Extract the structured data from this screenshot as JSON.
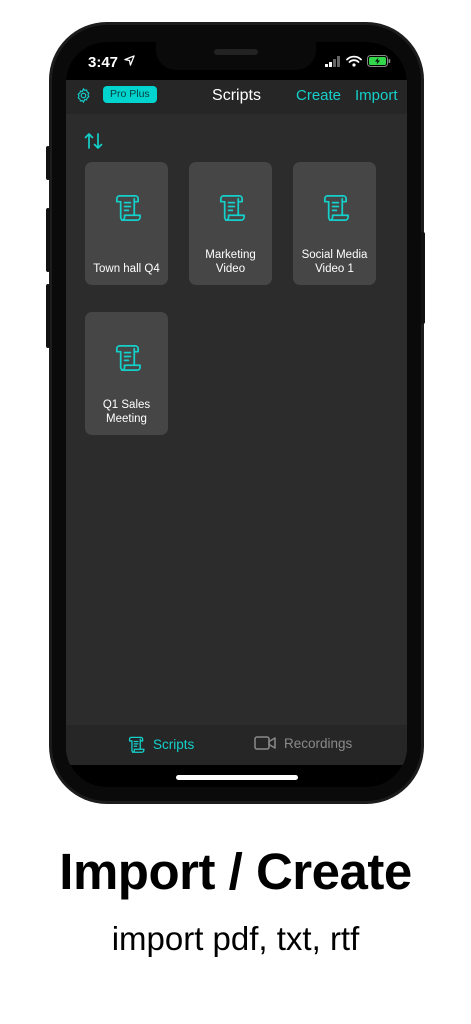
{
  "status_bar": {
    "time": "3:47"
  },
  "nav": {
    "badge": "Pro Plus",
    "title": "Scripts",
    "create": "Create",
    "import": "Import"
  },
  "scripts": [
    {
      "title": "Town hall Q4"
    },
    {
      "title": "Marketing\nVideo"
    },
    {
      "title": "Social Media\nVideo 1"
    },
    {
      "title": "Q1 Sales\nMeeting"
    }
  ],
  "tabs": {
    "scripts": "Scripts",
    "recordings": "Recordings"
  },
  "colors": {
    "accent": "#14d0cb",
    "background": "#2c2c2c",
    "card": "#464646",
    "inactive": "#8a8a8a"
  },
  "caption": {
    "headline": "Import / Create",
    "subtitle": "import pdf, txt, rtf"
  }
}
